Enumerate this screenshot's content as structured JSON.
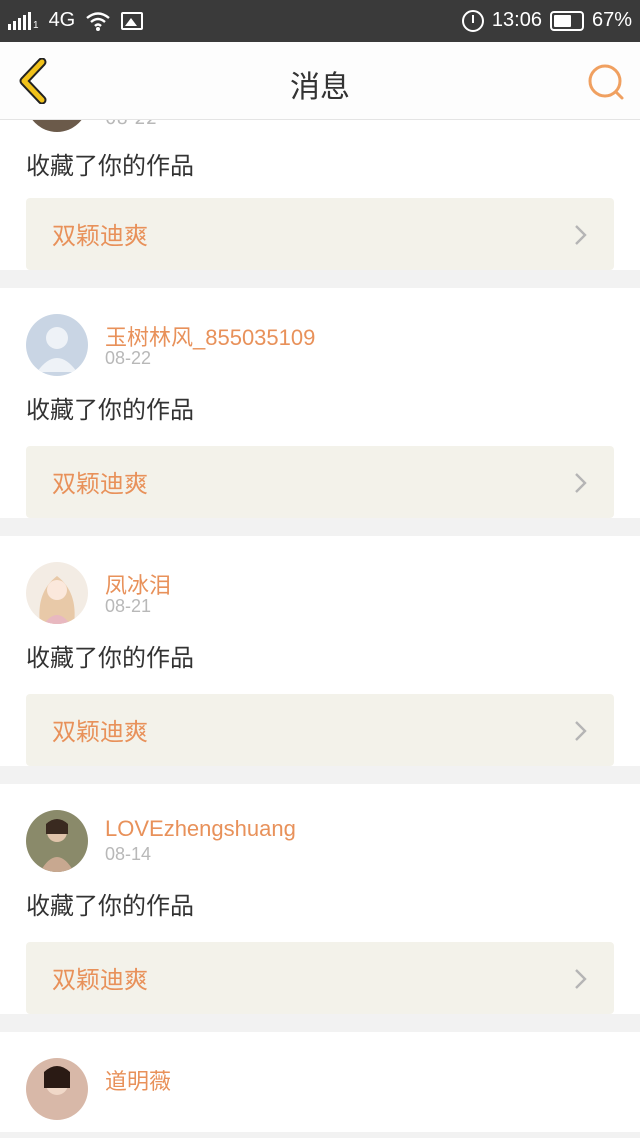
{
  "status_bar": {
    "network": "4G",
    "time": "13:06",
    "battery": "67%",
    "battery_level": 0.67
  },
  "header": {
    "title": "消息",
    "back_icon": "chevron-left-icon",
    "search_icon": "search-icon"
  },
  "feed": {
    "partial_top": {
      "date": "08-22",
      "action": "收藏了你的作品",
      "work": "双颖迪爽"
    },
    "items": [
      {
        "user": "玉树林风_855035109",
        "date": "08-22",
        "action": "收藏了你的作品",
        "work": "双颖迪爽"
      },
      {
        "user": "凤冰泪",
        "date": "08-21",
        "action": "收藏了你的作品",
        "work": "双颖迪爽"
      },
      {
        "user": "LOVEzhengshuang",
        "date": "08-14",
        "action": "收藏了你的作品",
        "work": "双颖迪爽"
      },
      {
        "user": "道明薇",
        "date": "",
        "action": "",
        "work": ""
      }
    ]
  },
  "colors": {
    "accent": "#e8915a",
    "back_arrow": "#f1c21b",
    "status_bar": "#3a3a3a",
    "work_bg": "#f3f2ea"
  }
}
